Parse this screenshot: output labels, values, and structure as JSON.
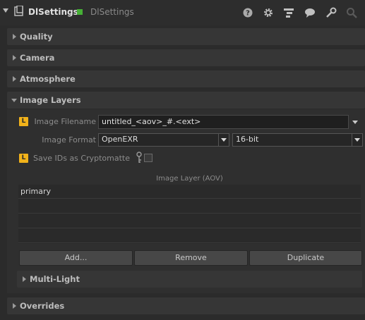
{
  "header": {
    "title": "DlSettings",
    "subtitle": "DlSettings",
    "icons": [
      "question-icon",
      "gear-icon",
      "node-graph-icon",
      "comment-icon",
      "wrench-icon",
      "search-icon"
    ]
  },
  "sections": {
    "quality": "Quality",
    "camera": "Camera",
    "atmosphere": "Atmosphere",
    "image_layers": "Image Layers",
    "multi_light": "Multi-Light",
    "overrides": "Overrides"
  },
  "image_layers": {
    "badge": "L",
    "filename_label": "Image Filename",
    "filename_value": "untitled_<aov>_#.<ext>",
    "format_label": "Image Format",
    "format_value": "OpenEXR",
    "bitdepth_value": "16-bit",
    "cryptomatte_label": "Save IDs as Cryptomatte",
    "list_header": "Image Layer (AOV)",
    "rows": [
      "primary",
      "",
      "",
      ""
    ],
    "buttons": {
      "add": "Add...",
      "remove": "Remove",
      "duplicate": "Duplicate"
    }
  },
  "colors": {
    "background": "#2b2b2b",
    "section": "#363636",
    "accent_badge": "#f1b21a",
    "status_green": "#46b036"
  }
}
